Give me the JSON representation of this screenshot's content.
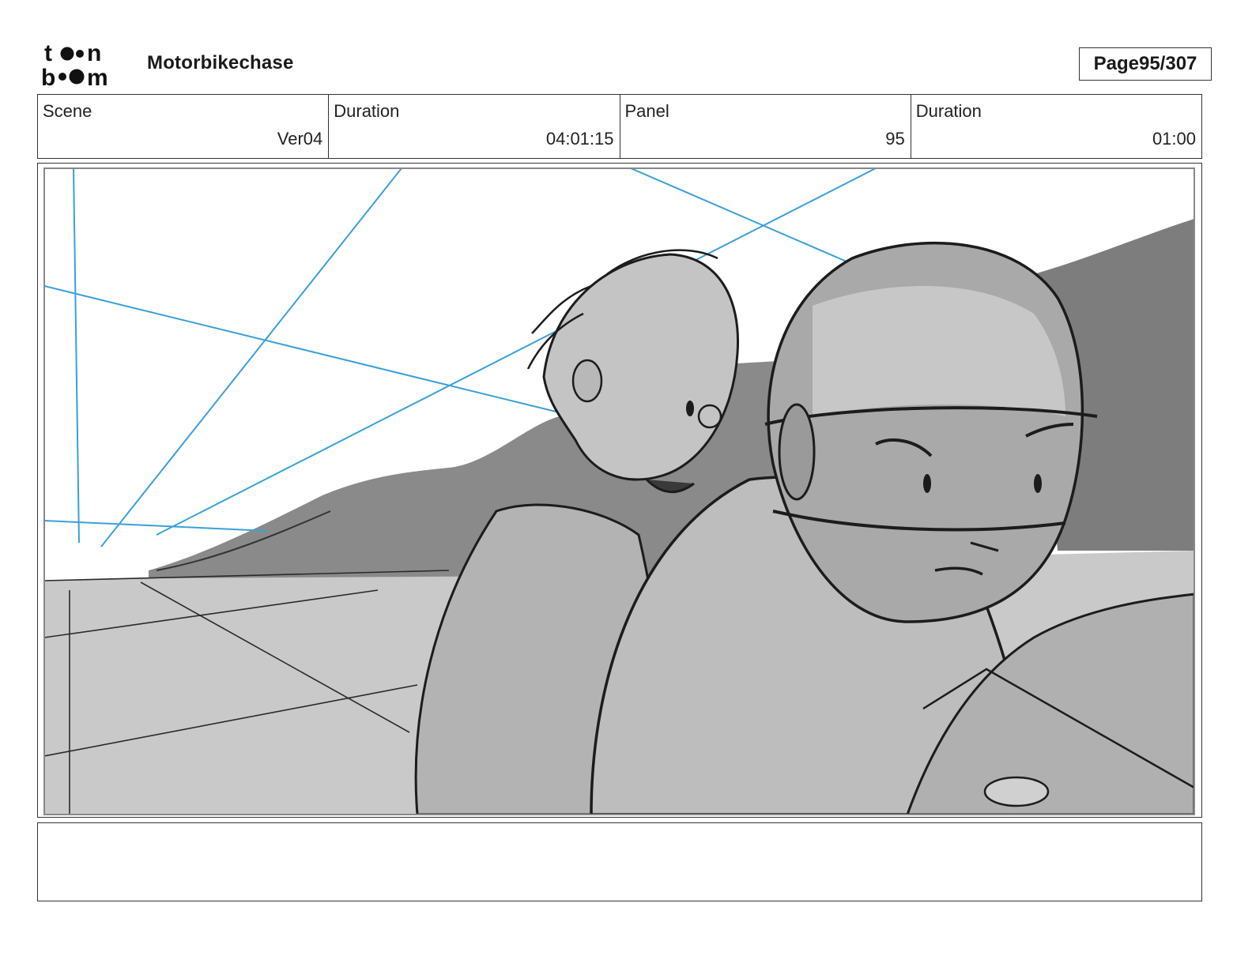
{
  "header": {
    "logo_text": "toon boom",
    "project_title": "Motorbikechase",
    "page_label": "Page",
    "page_number": "95/307"
  },
  "info_table": {
    "scene_label": "Scene",
    "scene_value": "Ver04",
    "scene_duration_label": "Duration",
    "scene_duration_value": "04:01:15",
    "panel_label": "Panel",
    "panel_value": "95",
    "panel_duration_label": "Duration",
    "panel_duration_value": "01:00"
  },
  "panel": {
    "image_subject": "storyboard-sketch-two-riders-on-motorbike",
    "colors": {
      "perspective_lines": "#3aa0d8",
      "ink": "#1c1c1c",
      "fill_light": "#c8c8c8",
      "fill_mid": "#a8a8a8",
      "fill_dark": "#7c7c7c"
    }
  },
  "notes": {
    "text": ""
  }
}
